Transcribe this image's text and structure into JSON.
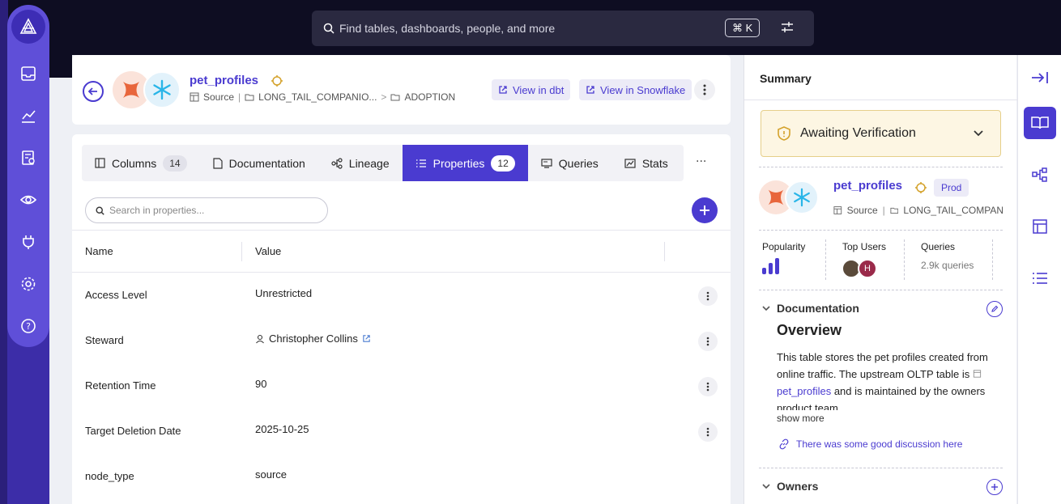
{
  "search": {
    "placeholder": "Find tables, dashboards, people, and more",
    "shortcut": "⌘ K"
  },
  "asset": {
    "name": "pet_profiles",
    "crumbs": [
      "Source",
      "LONG_TAIL_COMPANIO...",
      "ADOPTION"
    ],
    "actions": {
      "view_dbt": "View in dbt",
      "view_snowflake": "View in Snowflake"
    }
  },
  "tabs": [
    {
      "label": "Columns",
      "count": "14",
      "icon": "columns-icon"
    },
    {
      "label": "Documentation",
      "count": "",
      "icon": "document-icon"
    },
    {
      "label": "Lineage",
      "count": "",
      "icon": "lineage-icon"
    },
    {
      "label": "Properties",
      "count": "12",
      "icon": "list-icon",
      "active": true
    },
    {
      "label": "Queries",
      "count": "",
      "icon": "queries-icon"
    },
    {
      "label": "Stats",
      "count": "",
      "icon": "stats-icon"
    }
  ],
  "tabs_more": "···",
  "properties": {
    "search_placeholder": "Search in properties...",
    "headers": {
      "name": "Name",
      "value": "Value"
    },
    "rows": [
      {
        "name": "Access Level",
        "value": "Unrestricted"
      },
      {
        "name": "Steward",
        "value": "Christopher Collins",
        "person": true
      },
      {
        "name": "Retention Time",
        "value": "90"
      },
      {
        "name": "Target Deletion Date",
        "value": "2025-10-25"
      },
      {
        "name": "node_type",
        "value": "source"
      }
    ]
  },
  "summary": {
    "title": "Summary",
    "verification": "Awaiting Verification",
    "name": "pet_profiles",
    "env_badge": "Prod",
    "crumbs": [
      "Source",
      "LONG_TAIL_COMPAN"
    ],
    "stats": {
      "popularity": "Popularity",
      "top_users": "Top Users",
      "queries": "Queries",
      "queries_value": "2.9k queries",
      "user_initial": "H"
    },
    "documentation": {
      "label": "Documentation",
      "heading": "Overview",
      "text_before": "This table stores the pet profiles created from online traffic. The upstream OLTP table is ",
      "link": "pet_profiles",
      "text_after": " and is maintained by the owners product team.",
      "show_more": "show more",
      "discussion": "There was some good discussion here"
    },
    "owners": {
      "label": "Owners"
    }
  },
  "colors": {
    "accent": "#4a3bd0",
    "sidebar": "#5f4fd8",
    "topbar": "#0e0d22"
  }
}
